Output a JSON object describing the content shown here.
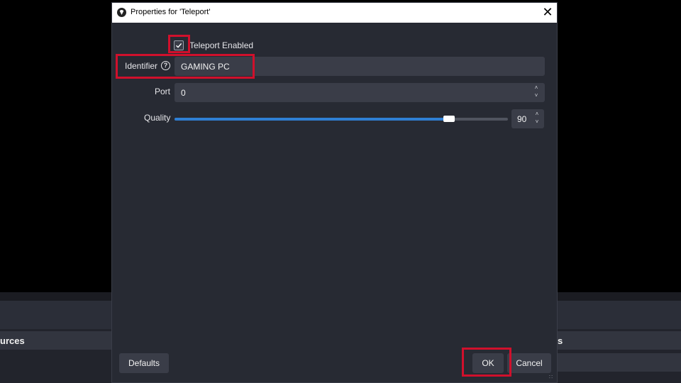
{
  "background": {
    "left_panel_title": "urces",
    "right_panel_title": "s"
  },
  "dialog": {
    "title": "Properties for 'Teleport'",
    "close_glyph": "✕",
    "teleport_enabled": {
      "label": "Teleport Enabled",
      "checked": true
    },
    "identifier": {
      "label": "Identifier",
      "value": "GAMING PC",
      "help_glyph": "?"
    },
    "port": {
      "label": "Port",
      "value": "0"
    },
    "quality": {
      "label": "Quality",
      "value": "90",
      "max": 100
    },
    "buttons": {
      "defaults": "Defaults",
      "ok": "OK",
      "cancel": "Cancel"
    }
  },
  "colors": {
    "accent": "#2f7fd4",
    "highlight": "#d0102c",
    "dialog_bg": "#272a33",
    "field_bg": "#3a3d48"
  },
  "icons": [
    "obs-icon",
    "close-icon",
    "help-icon",
    "checkmark-icon",
    "spin-up-icon",
    "spin-down-icon",
    "resize-grip-icon"
  ]
}
